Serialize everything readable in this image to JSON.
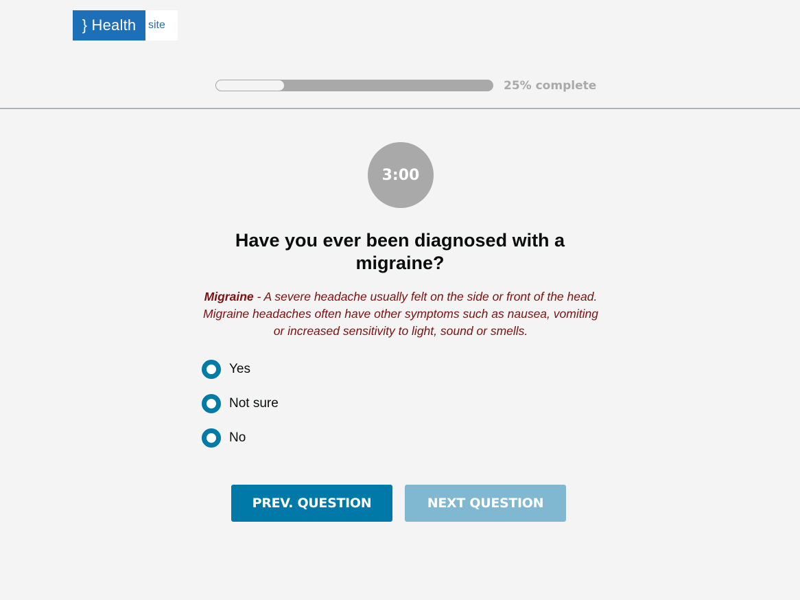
{
  "logo": {
    "main": "} Health",
    "sub": "site"
  },
  "progress": {
    "percent": 25,
    "label": "25% complete"
  },
  "timer": {
    "value": "3:00"
  },
  "question": {
    "text": "Have you ever been diagnosed with a migraine?",
    "definition_term": "Migraine",
    "definition_text": " - A severe headache usually felt on the side or front of the head. Migraine headaches often have other symptoms such as nausea, vomiting or increased sensitivity to light, sound or smells."
  },
  "options": [
    {
      "label": "Yes"
    },
    {
      "label": "Not sure"
    },
    {
      "label": "No"
    }
  ],
  "buttons": {
    "prev": "PREV. QUESTION",
    "next": "NEXT QUESTION"
  },
  "colors": {
    "brand": "#1d70b8",
    "radio": "#007aa7",
    "button_primary": "#0079a8",
    "button_disabled": "#7fb8d0",
    "definition": "#7d1010",
    "muted": "#a9a9a9"
  }
}
